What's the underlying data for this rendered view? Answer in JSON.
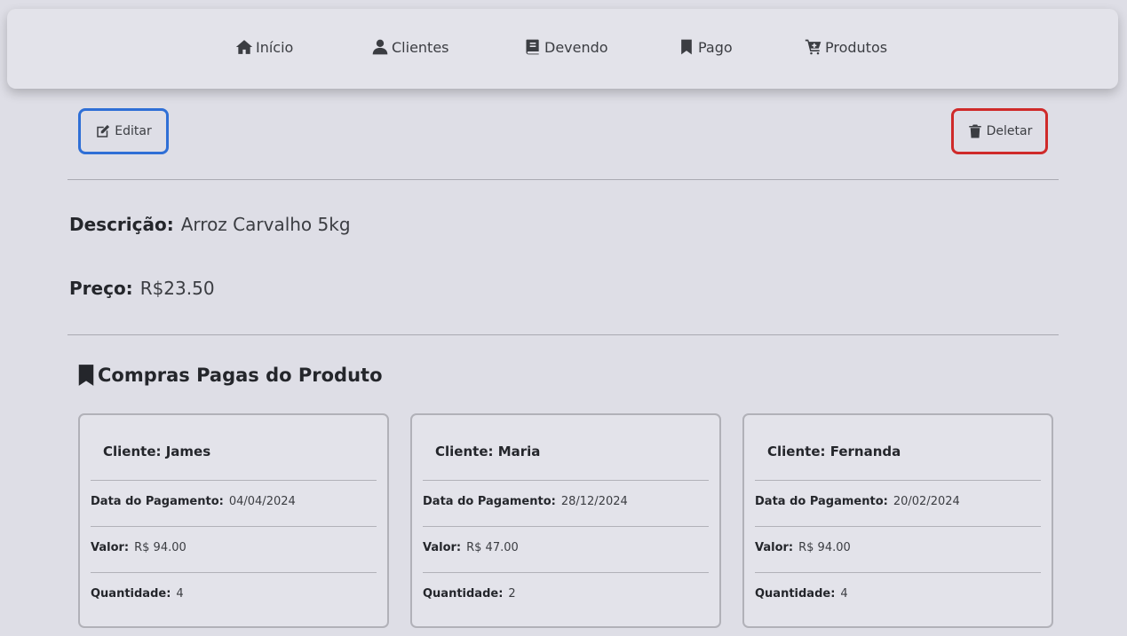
{
  "nav": {
    "items": [
      {
        "label": "Início",
        "icon": "home-icon"
      },
      {
        "label": "Clientes",
        "icon": "user-icon"
      },
      {
        "label": "Devendo",
        "icon": "book-icon"
      },
      {
        "label": "Pago",
        "icon": "bookmark-icon"
      },
      {
        "label": "Produtos",
        "icon": "cart-plus-icon"
      }
    ]
  },
  "actions": {
    "edit_label": "Editar",
    "edit_icon": "edit-icon",
    "edit_color": "#2f6fd6",
    "delete_label": "Deletar",
    "delete_icon": "trash-icon",
    "delete_color": "#cf2a2a"
  },
  "product": {
    "description_label": "Descrição:",
    "description": "Arroz Carvalho 5kg",
    "price_label": "Preço:",
    "price": "R$23.50"
  },
  "purchases": {
    "title": "Compras Pagas do Produto",
    "title_icon": "bookmark-icon",
    "cards": [
      {
        "client_label": "Cliente: James",
        "date_label": "Data do Pagamento:",
        "date": "04/04/2024",
        "value_label": "Valor:",
        "value": "R$ 94.00",
        "qty_label": "Quantidade:",
        "qty": "4"
      },
      {
        "client_label": "Cliente: Maria",
        "date_label": "Data do Pagamento:",
        "date": "28/12/2024",
        "value_label": "Valor:",
        "value": "R$ 47.00",
        "qty_label": "Quantidade:",
        "qty": "2"
      },
      {
        "client_label": "Cliente: Fernanda",
        "date_label": "Data do Pagamento:",
        "date": "20/02/2024",
        "value_label": "Valor:",
        "value": "R$ 94.00",
        "qty_label": "Quantidade:",
        "qty": "4"
      }
    ]
  }
}
